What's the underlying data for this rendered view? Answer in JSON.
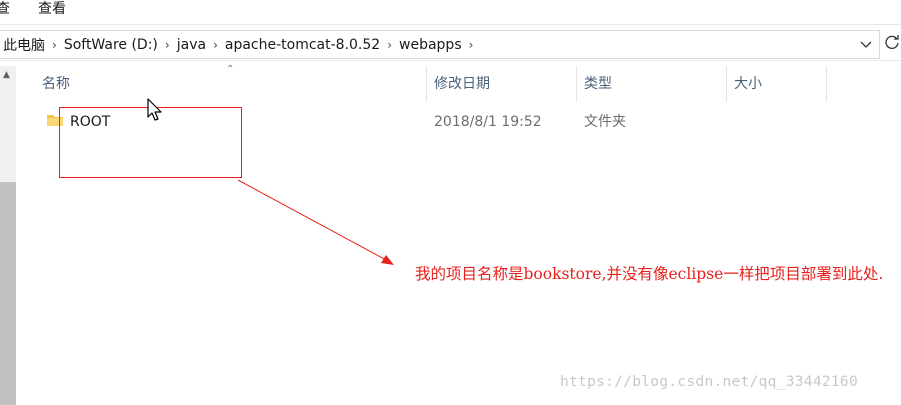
{
  "menubar": {
    "left_partial": "查",
    "view_label": "查看"
  },
  "address": {
    "crumbs": [
      "此电脑",
      "SoftWare (D:)",
      "java",
      "apache-tomcat-8.0.52",
      "webapps"
    ],
    "separator": "›"
  },
  "columns": {
    "name": "名称",
    "modified": "修改日期",
    "type": "类型",
    "size": "大小"
  },
  "rows": [
    {
      "name": "ROOT",
      "modified": "2018/8/1 19:52",
      "type": "文件夹",
      "size": ""
    }
  ],
  "annotation": {
    "text": "我的项目名称是bookstore,并没有像eclipse一样把项目部署到此处."
  },
  "watermark": "https://blog.csdn.net/qq_33442160",
  "colors": {
    "annotation_red": "#e8211c",
    "header_text": "#4c607a",
    "folder_yellow": "#f3c34b"
  }
}
